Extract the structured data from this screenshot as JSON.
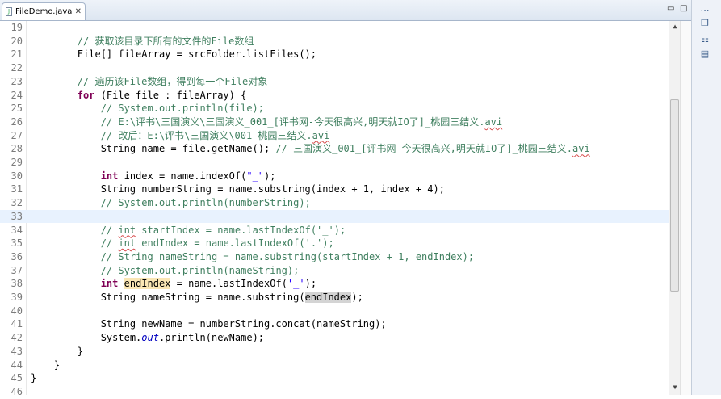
{
  "editor_tab": {
    "title": "FileDemo.java",
    "file_icon": "java-file-icon",
    "close_glyph": "✕"
  },
  "window_controls": {
    "minimize": "▭",
    "maximize": "□"
  },
  "right_panel": {
    "icons": [
      "view-menu-icon",
      "restore-icon",
      "outline-icon",
      "task-list-icon"
    ]
  },
  "current_line": 33,
  "lines": [
    {
      "n": "19",
      "t": []
    },
    {
      "n": "20",
      "t": [
        [
          "",
          "        "
        ],
        [
          "cm",
          "// 获取该目录下所有的文件的File数组"
        ]
      ]
    },
    {
      "n": "21",
      "t": [
        [
          "",
          "        File[] fileArray = srcFolder.listFiles();"
        ]
      ]
    },
    {
      "n": "22",
      "t": []
    },
    {
      "n": "23",
      "t": [
        [
          "",
          "        "
        ],
        [
          "cm",
          "// 遍历该File数组，得到每一个File对象"
        ]
      ]
    },
    {
      "n": "24",
      "t": [
        [
          "",
          "        "
        ],
        [
          "kw",
          "for"
        ],
        [
          "",
          " (File file : fileArray) {"
        ]
      ]
    },
    {
      "n": "25",
      "t": [
        [
          "",
          "            "
        ],
        [
          "cm",
          "// System.out.println(file);"
        ]
      ]
    },
    {
      "n": "26",
      "t": [
        [
          "",
          "            "
        ],
        [
          "cm",
          "// E:\\评书\\三国演义\\三国演义_001_[评书网-今天很高兴,明天就IO了]_桃园三结义."
        ],
        [
          "cm sq",
          "avi"
        ]
      ]
    },
    {
      "n": "27",
      "t": [
        [
          "",
          "            "
        ],
        [
          "cm",
          "// 改后：E:\\评书\\三国演义\\001_桃园三结义."
        ],
        [
          "cm sq",
          "avi"
        ]
      ]
    },
    {
      "n": "28",
      "t": [
        [
          "",
          "            String name = file.getName(); "
        ],
        [
          "cm",
          "// 三国演义_001_[评书网-今天很高兴,明天就IO了]_桃园三结义."
        ],
        [
          "cm sq",
          "avi"
        ]
      ]
    },
    {
      "n": "29",
      "t": []
    },
    {
      "n": "30",
      "t": [
        [
          "",
          "            "
        ],
        [
          "kw",
          "int"
        ],
        [
          "",
          " index = name.indexOf("
        ],
        [
          "st",
          "\"_\""
        ],
        [
          "",
          ");"
        ]
      ]
    },
    {
      "n": "31",
      "t": [
        [
          "",
          "            String numberString = name.substring(index + 1, index + 4);"
        ]
      ]
    },
    {
      "n": "32",
      "t": [
        [
          "",
          "            "
        ],
        [
          "cm",
          "// System.out.println(numberString);"
        ]
      ]
    },
    {
      "n": "33",
      "t": []
    },
    {
      "n": "34",
      "t": [
        [
          "",
          "            "
        ],
        [
          "cm",
          "// "
        ],
        [
          "cm sq",
          "int"
        ],
        [
          "cm",
          " startIndex = name.lastIndexOf('_');"
        ]
      ]
    },
    {
      "n": "35",
      "t": [
        [
          "",
          "            "
        ],
        [
          "cm",
          "// "
        ],
        [
          "cm sq",
          "int"
        ],
        [
          "cm",
          " endIndex = name.lastIndexOf('.');"
        ]
      ]
    },
    {
      "n": "36",
      "t": [
        [
          "",
          "            "
        ],
        [
          "cm",
          "// String nameString = name.substring(startIndex + 1, endIndex);"
        ]
      ]
    },
    {
      "n": "37",
      "t": [
        [
          "",
          "            "
        ],
        [
          "cm",
          "// System.out.println(nameString);"
        ]
      ]
    },
    {
      "n": "38",
      "t": [
        [
          "",
          "            "
        ],
        [
          "kw",
          "int"
        ],
        [
          "",
          " "
        ],
        [
          "hl1",
          "endIndex"
        ],
        [
          "",
          " = name.lastIndexOf("
        ],
        [
          "st",
          "'_'"
        ],
        [
          "",
          ");"
        ]
      ]
    },
    {
      "n": "39",
      "t": [
        [
          "",
          "            String nameString = name.substring("
        ],
        [
          "hl2",
          "endIndex"
        ],
        [
          "",
          ");"
        ]
      ]
    },
    {
      "n": "40",
      "t": []
    },
    {
      "n": "41",
      "t": [
        [
          "",
          "            String newName = numberString.concat(nameString);"
        ]
      ]
    },
    {
      "n": "42",
      "t": [
        [
          "",
          "            System."
        ],
        [
          "it",
          "out"
        ],
        [
          "",
          ".println(newName);"
        ]
      ]
    },
    {
      "n": "43",
      "t": [
        [
          "",
          "        }"
        ]
      ]
    },
    {
      "n": "44",
      "t": [
        [
          "",
          "    }"
        ]
      ]
    },
    {
      "n": "45",
      "t": [
        [
          "",
          "}"
        ]
      ]
    },
    {
      "n": "46",
      "t": []
    }
  ],
  "scrollbar": {
    "position": 0.42,
    "visible_fraction": 0.55
  }
}
